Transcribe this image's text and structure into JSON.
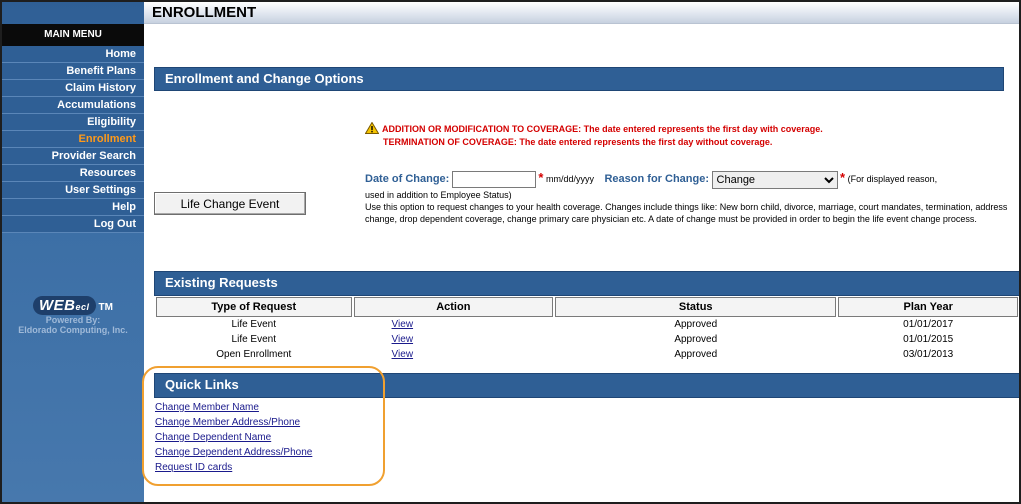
{
  "header": {
    "title": "ENROLLMENT"
  },
  "sidebar": {
    "heading": "MAIN MENU",
    "items": [
      {
        "label": "Home",
        "active": false
      },
      {
        "label": "Benefit Plans",
        "active": false
      },
      {
        "label": "Claim History",
        "active": false
      },
      {
        "label": "Accumulations",
        "active": false
      },
      {
        "label": "Eligibility",
        "active": false
      },
      {
        "label": "Enrollment",
        "active": true
      },
      {
        "label": "Provider Search",
        "active": false
      },
      {
        "label": "Resources",
        "active": false
      },
      {
        "label": "User Settings",
        "active": false
      },
      {
        "label": "Help",
        "active": false
      },
      {
        "label": "Log Out",
        "active": false
      }
    ],
    "logo": {
      "brand": "WEB",
      "brand_suffix": "ecl",
      "tm": "TM",
      "powered_by": "Powered By:",
      "company": "Eldorado Computing, Inc."
    }
  },
  "enrollment": {
    "section_title": "Enrollment and Change Options",
    "warning_line1": "ADDITION OR MODIFICATION TO COVERAGE: The date entered represents the first day with coverage.",
    "warning_line2": "TERMINATION OF COVERAGE: The date entered represents the first day without coverage.",
    "date_label": "Date of Change:",
    "date_value": "",
    "date_format": "mm/dd/yyyy",
    "reason_label": "Reason for Change:",
    "reason_value": "Change",
    "reason_note": "(For displayed reason,",
    "note_line1": "used in addition to Employee Status)",
    "note_line2": "Use this option to request changes to your health coverage. Changes include things like: New born child, divorce, marriage, court mandates, termination, address change, drop dependent coverage, change primary care physician etc. A date of change must be provided in order to begin the life event change process.",
    "life_button": "Life Change Event"
  },
  "requests": {
    "section_title": "Existing Requests",
    "columns": [
      "Type of Request",
      "Action",
      "Status",
      "Plan Year"
    ],
    "rows": [
      {
        "type": "Life Event",
        "action": "View",
        "status": "Approved",
        "plan_year": "01/01/2017"
      },
      {
        "type": "Life Event",
        "action": "View",
        "status": "Approved",
        "plan_year": "01/01/2015"
      },
      {
        "type": "Open Enrollment",
        "action": "View",
        "status": "Approved",
        "plan_year": "03/01/2013"
      }
    ]
  },
  "quick_links": {
    "section_title": "Quick Links",
    "items": [
      "Change Member Name",
      "Change Member Address/Phone",
      "Change Dependent Name",
      "Change Dependent Address/Phone",
      "Request ID cards"
    ]
  },
  "colors": {
    "nav_blue": "#2f5f95",
    "active_orange": "#ff9a1a",
    "warning_red": "#d40000",
    "highlight_orange": "#f0a030"
  }
}
